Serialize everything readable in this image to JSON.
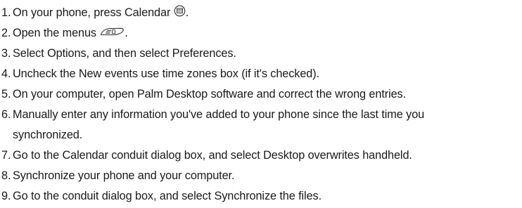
{
  "steps": [
    {
      "num": "1.",
      "text": "On your phone, press Calendar",
      "suffix": ".",
      "icon": "calendar-button-icon"
    },
    {
      "num": "2.",
      "text": "Open the menus",
      "suffix": ".",
      "icon": "menu-button-icon"
    },
    {
      "num": "3.",
      "text": "Select Options, and then select Preferences."
    },
    {
      "num": "4.",
      "text": "Uncheck the New events use time zones box (if it's checked)."
    },
    {
      "num": "5.",
      "text": "On your computer, open Palm Desktop software and correct the wrong entries."
    },
    {
      "num": "6.",
      "text": "Manually enter any information you've added to your phone since the last time you synchronized."
    },
    {
      "num": "7.",
      "text": "Go to the Calendar conduit dialog box, and select Desktop overwrites handheld."
    },
    {
      "num": "8.",
      "text": "Synchronize your phone and your computer."
    },
    {
      "num": "9.",
      "text": "Go to the conduit dialog box, and select Synchronize the files."
    }
  ]
}
